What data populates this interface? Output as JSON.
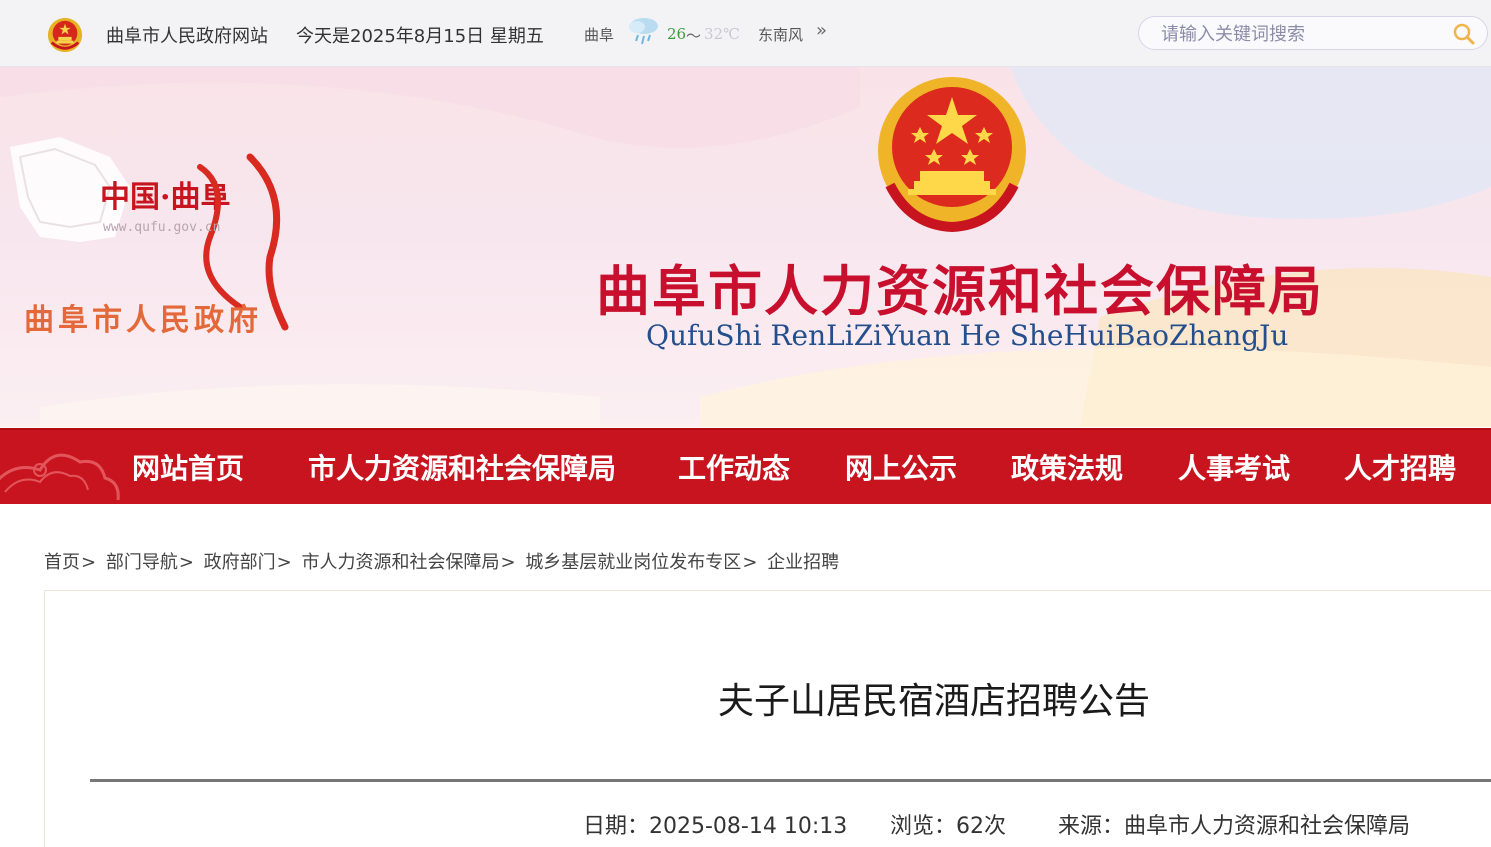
{
  "topbar": {
    "site_name": "曲阜市人民政府网站",
    "date_text": "今天是2025年8月15日 星期五",
    "weather": {
      "city": "曲阜",
      "icon": "rain-cloud-icon",
      "temp_low": "26",
      "separator": "～",
      "temp_high": "32℃",
      "wind": "东南风",
      "more_symbol": "»"
    },
    "search_placeholder": "请输入关键词搜索",
    "search_icon": "search-icon"
  },
  "banner": {
    "county_logo_text": "中国·曲阜",
    "county_logo_url": "www.qufu.gov.cn",
    "gov_label": "曲阜市人民政府",
    "bureau_title": "曲阜市人力资源和社会保障局",
    "bureau_pinyin": "QufuShi RenLiZiYuan He SheHuiBaoZhangJu"
  },
  "nav": {
    "items": [
      {
        "label": "网站首页"
      },
      {
        "label": "市人力资源和社会保障局"
      },
      {
        "label": "工作动态"
      },
      {
        "label": "网上公示"
      },
      {
        "label": "政策法规"
      },
      {
        "label": "人事考试"
      },
      {
        "label": "人才招聘"
      }
    ]
  },
  "breadcrumb": {
    "items": [
      "首页",
      "部门导航",
      "政府部门",
      "市人力资源和社会保障局",
      "城乡基层就业岗位发布专区",
      "企业招聘"
    ],
    "separator": ">"
  },
  "article": {
    "title": "夫子山居民宿酒店招聘公告",
    "date": "日期：2025-08-14 10:13",
    "views": "浏览：62次",
    "source": "来源：曲阜市人力资源和社会保障局"
  },
  "colors": {
    "nav_red": "#c8141f",
    "title_red": "#c8102e",
    "pinyin_blue": "#244e8c",
    "gov_orange": "#e3693a"
  }
}
